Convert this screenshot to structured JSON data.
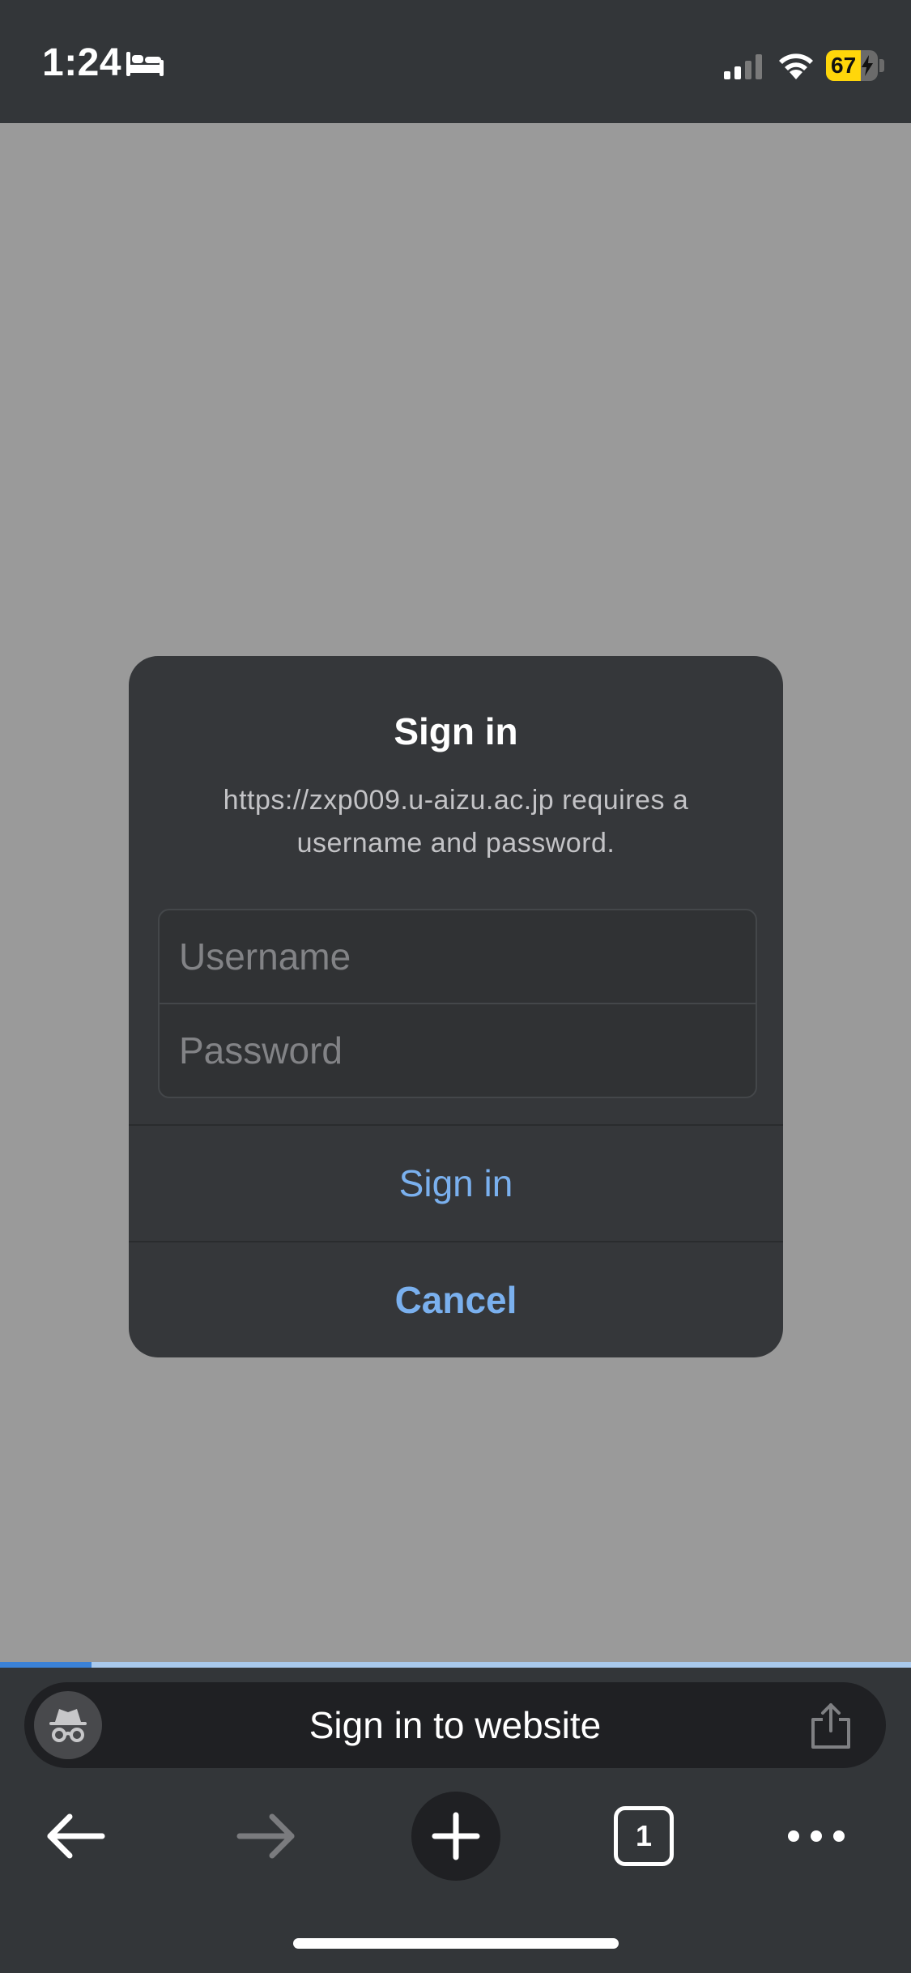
{
  "status_bar": {
    "time": "1:24",
    "battery": "67",
    "battery_level": 0.67,
    "icons": [
      "bed-icon",
      "cellular-signal-icon",
      "wifi-icon",
      "battery-charging-icon"
    ]
  },
  "dialog": {
    "title": "Sign in",
    "message": "https://zxp009.u-aizu.ac.jp requires a username and password.",
    "username_placeholder": "Username",
    "password_placeholder": "Password",
    "username_value": "",
    "password_value": "",
    "sign_in_label": "Sign in",
    "cancel_label": "Cancel"
  },
  "page_load_progress": 0.1,
  "omnibox": {
    "text": "Sign in to website",
    "left_icon": "incognito-icon",
    "right_icon": "share-icon"
  },
  "toolbar": {
    "tab_count": "1",
    "icons": [
      "back-arrow-icon",
      "forward-arrow-icon",
      "plus-icon",
      "tabs-icon",
      "more-icon"
    ]
  },
  "colors": {
    "chrome_bg": "#333639",
    "page_bg": "#9a9a9a",
    "dialog_bg": "#35373a",
    "accent": "#7ab0ee",
    "battery": "#ffd60a"
  }
}
